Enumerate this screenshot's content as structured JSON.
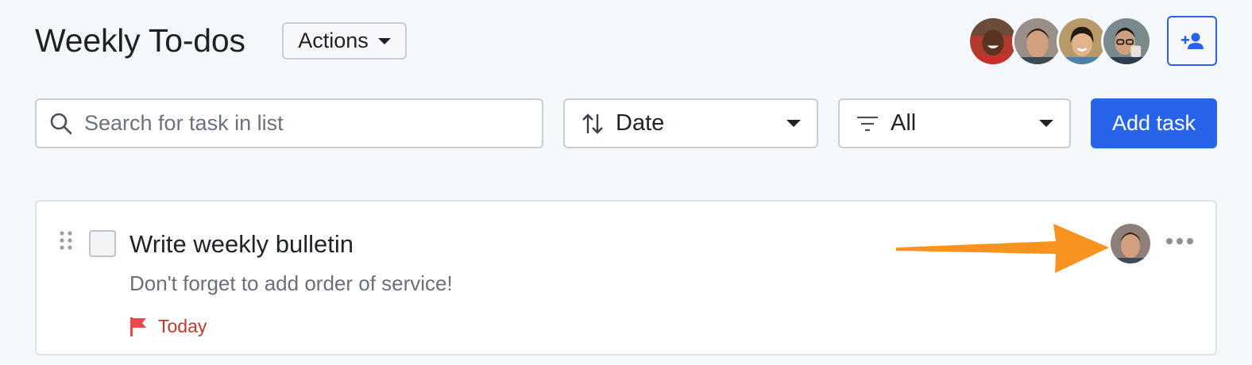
{
  "header": {
    "title": "Weekly To-dos",
    "actions_label": "Actions",
    "collaborators": [
      {
        "icon": "avatar-person-1"
      },
      {
        "icon": "avatar-person-2"
      },
      {
        "icon": "avatar-person-3"
      },
      {
        "icon": "avatar-person-4"
      }
    ],
    "invite_icon": "add-person-icon"
  },
  "toolbar": {
    "search_placeholder": "Search for task in list",
    "sort_label": "Date",
    "sort_icon": "sort-arrows-icon",
    "filter_label": "All",
    "filter_icon": "filter-lines-icon",
    "add_task_label": "Add task"
  },
  "task": {
    "title": "Write weekly bulletin",
    "description": "Don't forget to add order of service!",
    "due_label": "Today",
    "due_icon": "flag-icon",
    "assignee_icon": "avatar-person-2",
    "annotation": "orange-arrow-pointing-to-assignee"
  },
  "colors": {
    "accent": "#2764ea",
    "due": "#c0392b",
    "flag": "#e54b4b",
    "annotation_arrow": "#f7931e",
    "background": "#f5f8fc"
  }
}
